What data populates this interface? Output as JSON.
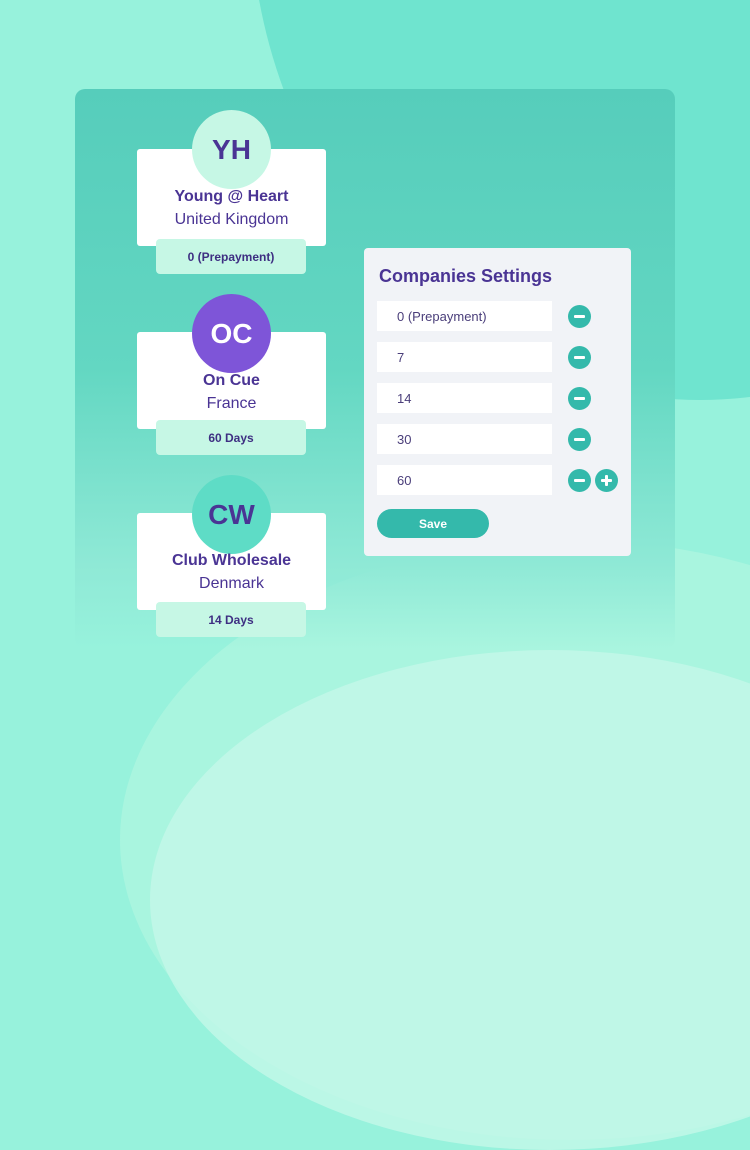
{
  "colors": {
    "accent": "#34b9ab",
    "primary_text": "#4a3494",
    "avatar_yh_bg": "#c6f7e5",
    "avatar_oc_bg": "#7e55d8",
    "avatar_cw_bg": "#5edcc6"
  },
  "companies": [
    {
      "initials": "YH",
      "name": "Young @ Heart",
      "country": "United Kingdom",
      "terms": "0 (Prepayment)"
    },
    {
      "initials": "OC",
      "name": "On Cue",
      "country": "France",
      "terms": "60 Days"
    },
    {
      "initials": "CW",
      "name": "Club Wholesale",
      "country": "Denmark",
      "terms": "14 Days"
    }
  ],
  "settings": {
    "title": "Companies Settings",
    "terms": [
      {
        "value": "0 (Prepayment)"
      },
      {
        "value": "7"
      },
      {
        "value": "14"
      },
      {
        "value": "30"
      },
      {
        "value": "60"
      }
    ],
    "save_label": "Save",
    "icons": {
      "remove": "minus-circle-icon",
      "add": "plus-circle-icon"
    }
  }
}
